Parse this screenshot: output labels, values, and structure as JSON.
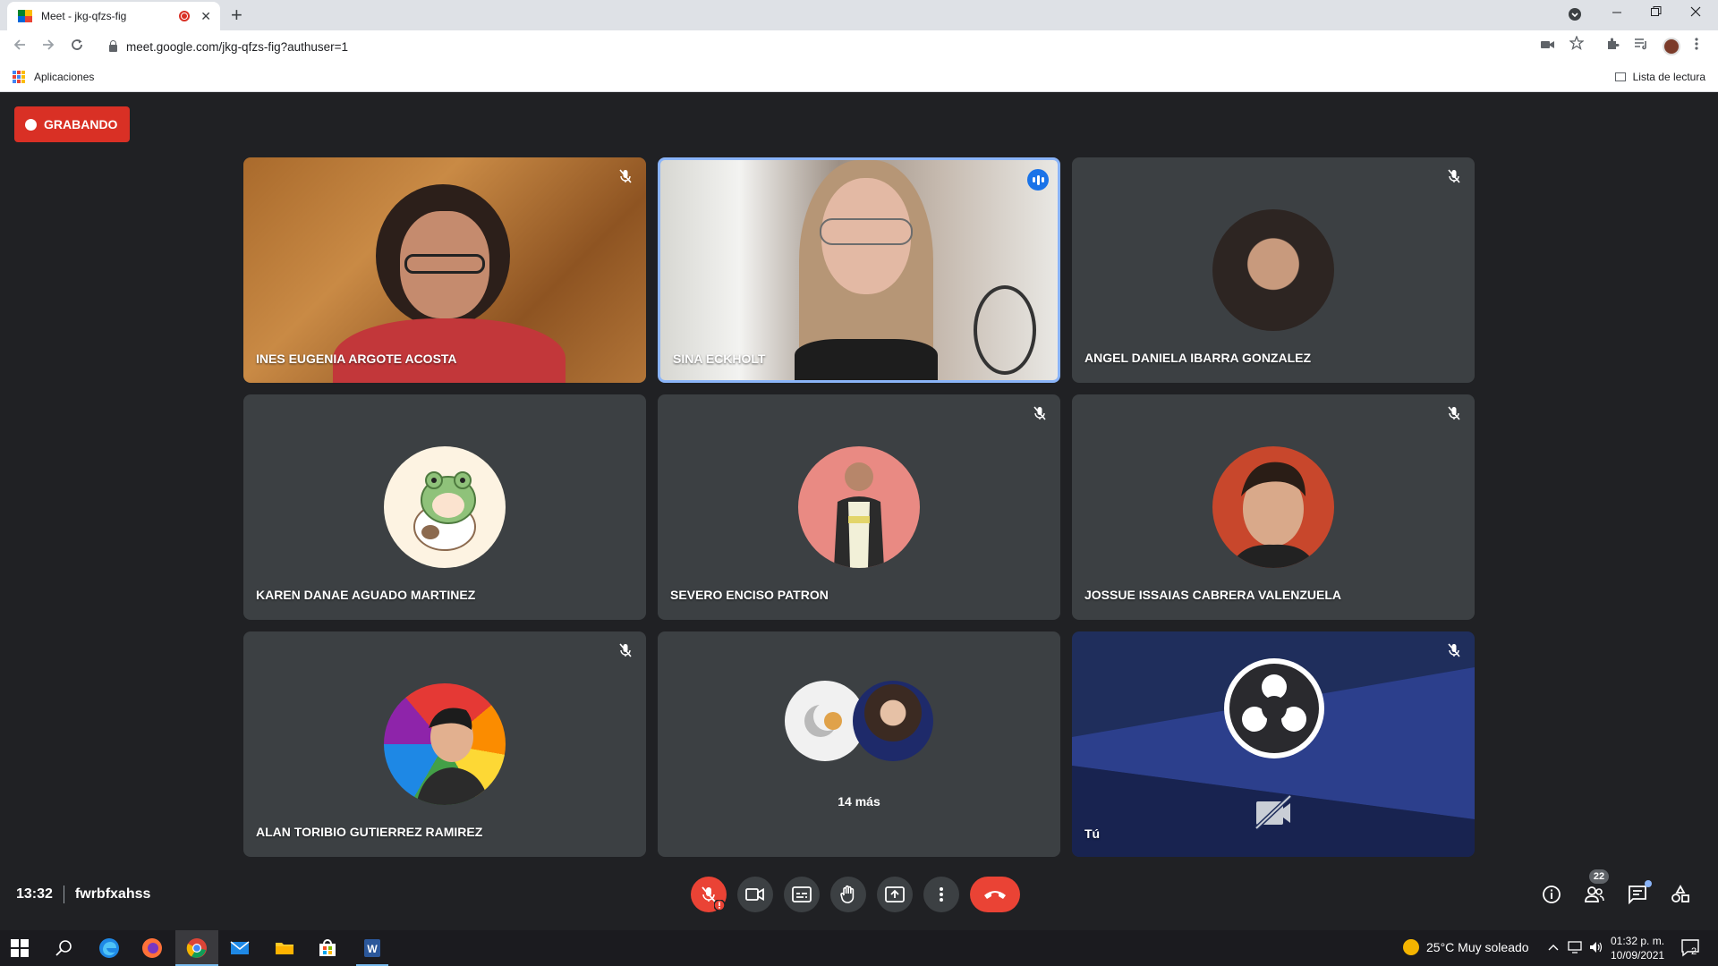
{
  "browser": {
    "tab_title": "Meet - jkg-qfzs-fig",
    "tab_close": "✕",
    "new_tab": "+",
    "url": "meet.google.com/jkg-qfzs-fig?authuser=1",
    "bookmarks_apps": "Aplicaciones",
    "reading_list": "Lista de lectura"
  },
  "meeting": {
    "recording_label": "GRABANDO",
    "time": "13:32",
    "code": "fwrbfxahss",
    "participants_count": "22",
    "participants": [
      {
        "name": "INES EUGENIA ARGOTE ACOSTA",
        "muted": true
      },
      {
        "name": "SINA ECKHOLT",
        "speaking": true
      },
      {
        "name": "ANGEL DANIELA IBARRA GONZALEZ",
        "muted": true
      },
      {
        "name": "KAREN DANAE AGUADO MARTINEZ"
      },
      {
        "name": "SEVERO ENCISO PATRON",
        "muted": true
      },
      {
        "name": "JOSSUE ISSAIAS CABRERA VALENZUELA",
        "muted": true
      },
      {
        "name": "ALAN TORIBIO GUTIERREZ RAMIREZ",
        "muted": true
      }
    ],
    "more_label": "14 más",
    "self_label": "Tú",
    "colors": {
      "accent": "#1a73e8",
      "record": "#d93025",
      "end_call": "#ea4335"
    }
  },
  "taskbar": {
    "weather": "25°C  Muy soleado",
    "time": "01:32 p. m.",
    "date": "10/09/2021",
    "notifications": "2"
  }
}
